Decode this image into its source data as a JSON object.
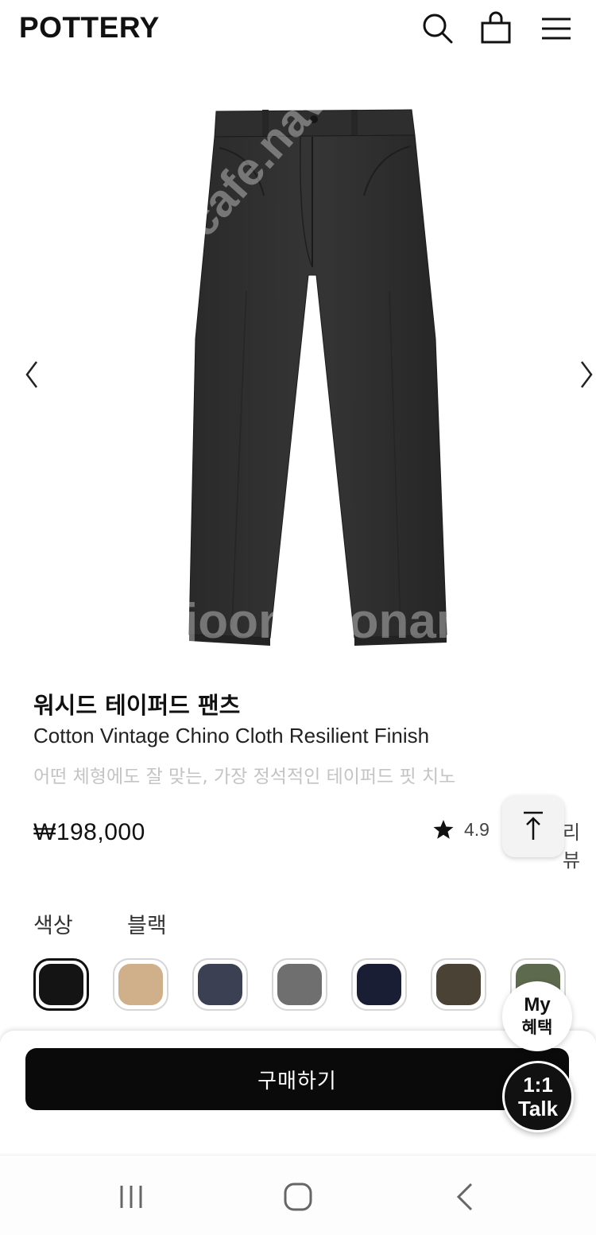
{
  "header": {
    "logo": "POTTERY",
    "icons": [
      "search-icon",
      "shopping-bag-icon",
      "menu-icon"
    ]
  },
  "gallery": {
    "image_alt": "Washed tapered pants in charcoal",
    "prev_icon": "chevron-left-icon",
    "next_icon": "chevron-right-icon",
    "watermark_a": "cafe.naver.com/joonggonara",
    "watermark_b": "joonggonara"
  },
  "product": {
    "title_kr": "워시드 테이퍼드 팬츠",
    "title_en": "Cotton Vintage Chino Cloth Resilient Finish",
    "subtitle": "어떤 체형에도 잘 맞는, 가장 정석적인 테이퍼드 핏 치노",
    "price": "₩198,000",
    "rating": "4.9",
    "review_label": "리뷰"
  },
  "color": {
    "label": "색상",
    "selected": "블랙",
    "swatches": [
      {
        "name": "black",
        "hex": "#141414"
      },
      {
        "name": "beige",
        "hex": "#cfb08a"
      },
      {
        "name": "slate-navy",
        "hex": "#3b4152"
      },
      {
        "name": "gray",
        "hex": "#6f6f6f"
      },
      {
        "name": "navy",
        "hex": "#1a1e35"
      },
      {
        "name": "brown",
        "hex": "#4a4234"
      },
      {
        "name": "olive",
        "hex": "#5e6a4d"
      }
    ]
  },
  "actions": {
    "buy_label": "구매하기",
    "my_line1": "My",
    "my_line2": "혜택",
    "talk_line1": "1:1",
    "talk_line2": "Talk"
  }
}
